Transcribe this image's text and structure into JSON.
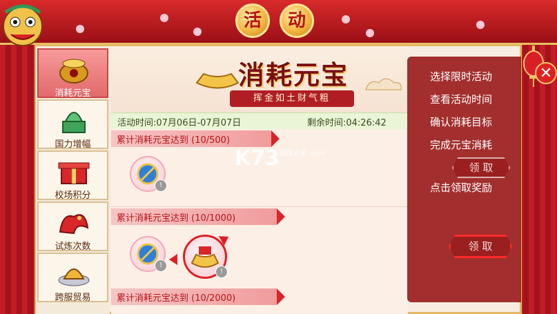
{
  "window": {
    "title_chars": [
      "活",
      "动"
    ]
  },
  "close_label": "✕",
  "sidebar": {
    "items": [
      {
        "label": "消耗元宝",
        "icon": "gold-pot-icon",
        "active": true
      },
      {
        "label": "国力增幅",
        "icon": "jade-seal-icon",
        "active": false
      },
      {
        "label": "校场积分",
        "icon": "gift-box-icon",
        "active": false
      },
      {
        "label": "试炼次数",
        "icon": "dragon-icon",
        "active": false
      },
      {
        "label": "跨服贸易",
        "icon": "treasure-icon",
        "active": false
      }
    ]
  },
  "banner": {
    "title": "消耗元宝",
    "subtitle": "挥金如土财气粗"
  },
  "info": {
    "period": "活动时间:07月06日-07月07日",
    "remaining": "剩余时间:04:26:42"
  },
  "tasks": [
    {
      "label": "累计消耗元宝达到 (10/500)"
    },
    {
      "label": "累计消耗元宝达到 (10/1000)"
    },
    {
      "label": "累计消耗元宝达到 (10/2000)"
    }
  ],
  "rewards": {
    "row1": [
      {
        "icon": "tag-scroll-icon",
        "badge": "!"
      }
    ],
    "row2": [
      {
        "icon": "tag-scroll-icon",
        "badge": "!"
      },
      {
        "icon": "gold-ingot-gift-icon",
        "badge": "!"
      }
    ]
  },
  "steps": {
    "items": [
      "选择限时活动",
      "查看活动时间",
      "确认消耗目标",
      "完成元宝消耗",
      "点击领取奖励"
    ],
    "claim_label": "领 取"
  },
  "watermark": {
    "main": "K73",
    "sub": "游戏之家 .com"
  },
  "colors": {
    "accent_red": "#d8262b",
    "gold": "#e3b766",
    "overlay": "#961414"
  }
}
